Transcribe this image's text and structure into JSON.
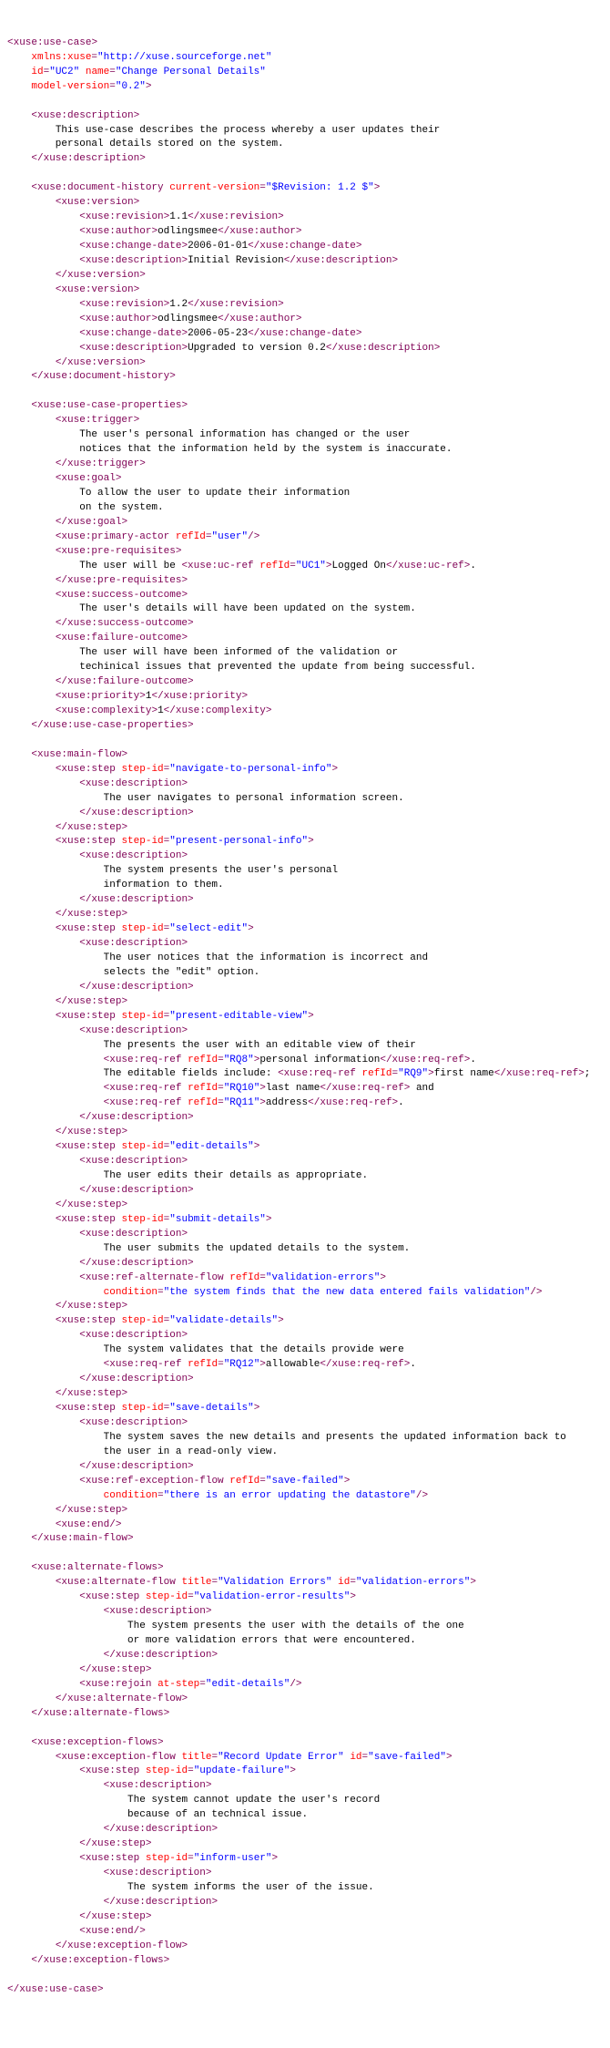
{
  "root": {
    "xmlns": "http://xuse.sourceforge.net",
    "id": "UC2",
    "name": "Change Personal Details",
    "modelVersion": "0.2"
  },
  "description": "This use-case describes the process whereby a user updates their\n        personal details stored on the system.",
  "documentHistory": {
    "currentVersion": "$Revision: 1.2 $",
    "versions": [
      {
        "revision": "1.1",
        "author": "odlingsmee",
        "changeDate": "2006-01-01",
        "description": "Initial Revision"
      },
      {
        "revision": "1.2",
        "author": "odlingsmee",
        "changeDate": "2006-05-23",
        "description": "Upgraded to version 0.2"
      }
    ]
  },
  "properties": {
    "trigger": "The user's personal information has changed or the user\n            notices that the information held by the system is inaccurate.",
    "goal": "To allow the user to update their information\n            on the system.",
    "primaryActorRefId": "user",
    "preRequisites": {
      "before": "The user will be ",
      "refId": "UC1",
      "refText": "Logged On",
      "after": "."
    },
    "successOutcome": "The user's details will have been updated on the system.",
    "failureOutcome": "The user will have been informed of the validation or\n            techinical issues that prevented the update from being successful.",
    "priority": "1",
    "complexity": "1"
  },
  "mainFlow": [
    {
      "stepId": "navigate-to-personal-info",
      "desc": "The user navigates to personal information screen."
    },
    {
      "stepId": "present-personal-info",
      "desc": "The system presents the user's personal\n                information to them."
    },
    {
      "stepId": "select-edit",
      "desc": "The user notices that the information is incorrect and\n                selects the \"edit\" option."
    },
    {
      "stepId": "present-editable-view",
      "complex": true
    },
    {
      "stepId": "edit-details",
      "desc": "The user edits their details as appropriate."
    },
    {
      "stepId": "submit-details",
      "desc": "The user submits the updated details to the system.",
      "refAltFlow": {
        "refId": "validation-errors",
        "condition": "the system finds that the new data entered fails validation"
      }
    },
    {
      "stepId": "validate-details",
      "complex": true
    },
    {
      "stepId": "save-details",
      "desc": "The system saves the new details and presents the updated information back to\n                the user in a read-only view.",
      "refExcFlow": {
        "refId": "save-failed",
        "condition": "there is an error updating the datastore"
      }
    }
  ],
  "editableView": {
    "line1before": "The presents the user with an editable view of their",
    "ref1": {
      "id": "RQ8",
      "text": "personal information"
    },
    "line2before": "The editable fields include: ",
    "ref2": {
      "id": "RQ9",
      "text": "first name"
    },
    "ref3": {
      "id": "RQ10",
      "text": "last name"
    },
    "ref4": {
      "id": "RQ11",
      "text": "address"
    }
  },
  "validateDetails": {
    "before": "The system validates that the details provide were",
    "ref": {
      "id": "RQ12",
      "text": "allowable"
    }
  },
  "alternateFlows": [
    {
      "title": "Validation Errors",
      "id": "validation-errors",
      "steps": [
        {
          "stepId": "validation-error-results",
          "desc": "The system presents the user with the details of the one\n                    or more validation errors that were encountered."
        }
      ],
      "rejoinAtStep": "edit-details"
    }
  ],
  "exceptionFlows": [
    {
      "title": "Record Update Error",
      "id": "save-failed",
      "steps": [
        {
          "stepId": "update-failure",
          "desc": "The system cannot update the user's record\n                    because of an technical issue."
        },
        {
          "stepId": "inform-user",
          "desc": "The system informs the user of the issue."
        }
      ]
    }
  ]
}
